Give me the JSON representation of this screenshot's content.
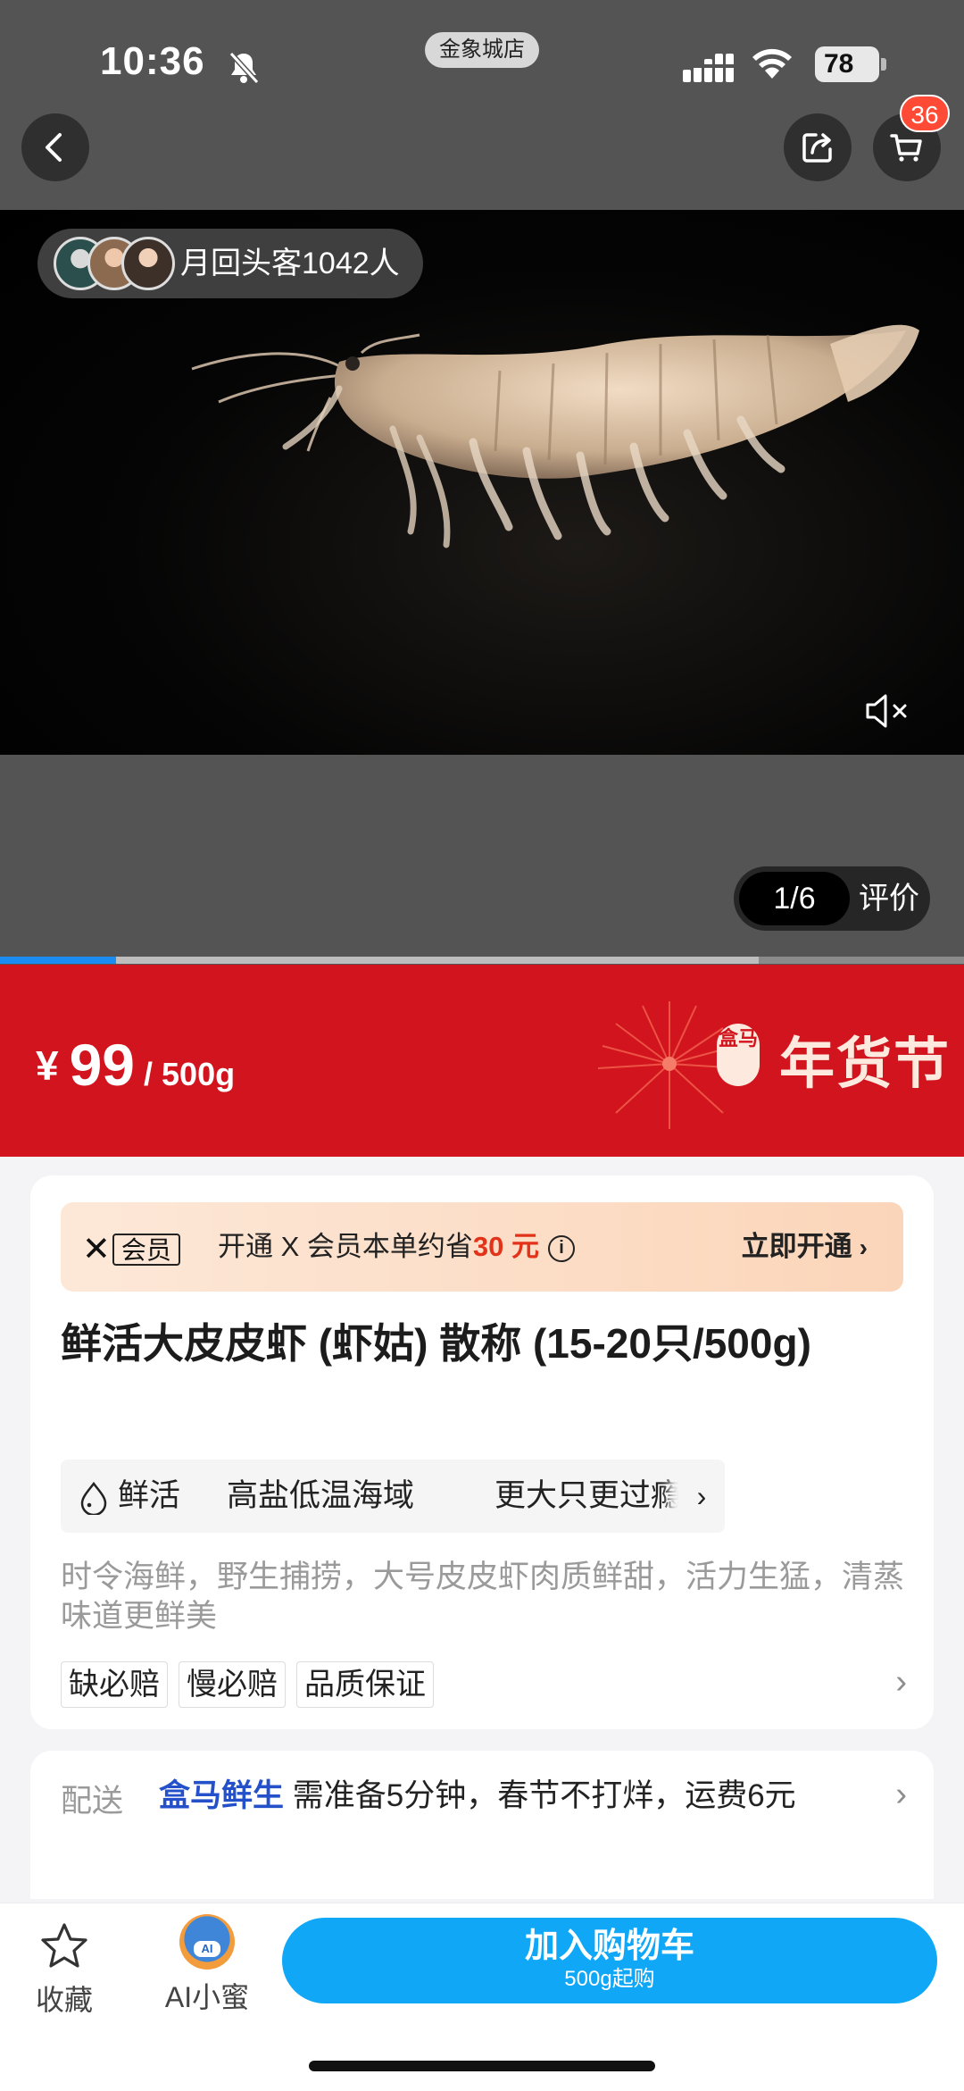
{
  "status_bar": {
    "time": "10:36",
    "store": "金象城店",
    "battery": "78"
  },
  "header": {
    "cart_count": "36"
  },
  "media": {
    "repeat_customers": "月回头客1042人",
    "counter": "1/6",
    "review_label": "评价",
    "progress": 0.12
  },
  "price": {
    "currency": "¥",
    "amount": "99",
    "unit": "/ 500g",
    "festival_brand": "盒马",
    "festival_text": "年货节"
  },
  "member": {
    "vip_label": "会员",
    "text_prefix": "开通 X 会员本单约省",
    "save_amount": "30 元",
    "cta": "立即开通"
  },
  "product": {
    "title": "鲜活大皮皮虾 (虾姑) 散称 (15-20只/500g)",
    "features": [
      "鲜活",
      "高盐低温海域",
      "更大只更过瘾"
    ],
    "description": "时令海鲜，野生捕捞，大号皮皮虾肉质鲜甜，活力生猛，清蒸味道更鲜美",
    "guarantees": [
      "缺必赔",
      "慢必赔",
      "品质保证"
    ]
  },
  "delivery": {
    "label": "配送",
    "brand": "盒马鲜生",
    "text": "需准备5分钟，春节不打烊，运费6元"
  },
  "bottom_bar": {
    "favorite": "收藏",
    "ai_badge": "AI",
    "ai_label": "AI小蜜",
    "cart_button": "加入购物车",
    "cart_sub": "500g起购"
  },
  "colors": {
    "price_banner": "#d1141d",
    "cta": "#10a7f7",
    "accent_red": "#e3321a",
    "brand_blue": "#2451c9"
  }
}
